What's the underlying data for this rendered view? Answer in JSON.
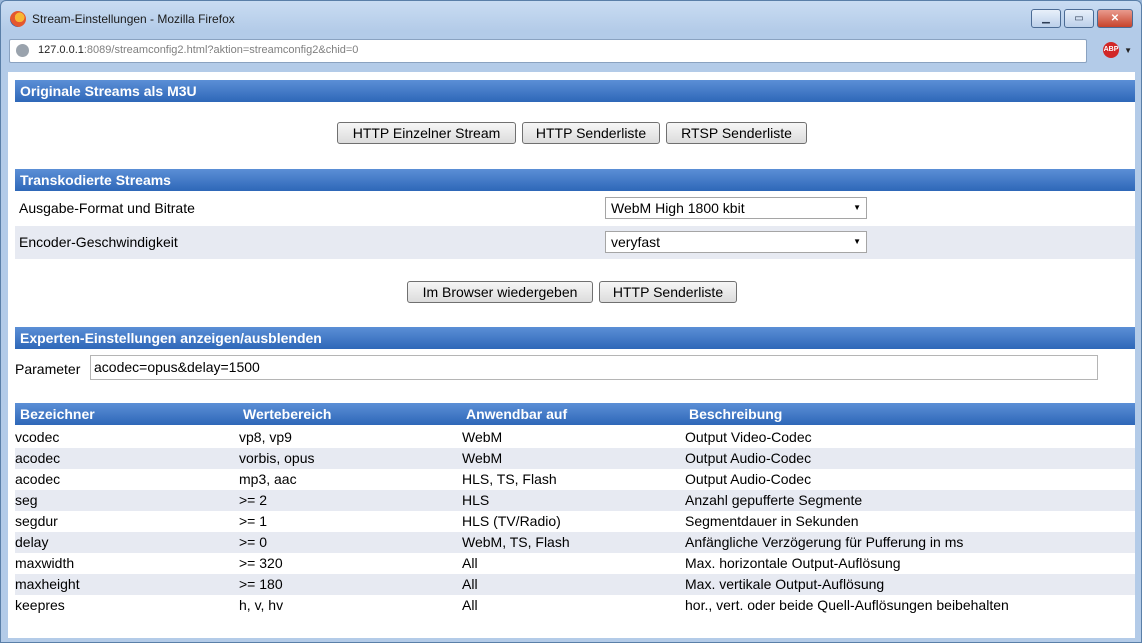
{
  "window": {
    "title": "Stream-Einstellungen - Mozilla Firefox"
  },
  "browser": {
    "url_host": "127.0.0.1",
    "url_rest": ":8089/streamconfig2.html?aktion=streamconfig2&chid=0",
    "addon": "ABP"
  },
  "section1": {
    "title": "Originale Streams als M3U",
    "buttons": [
      "HTTP Einzelner Stream",
      "HTTP Senderliste",
      "RTSP Senderliste"
    ]
  },
  "section2": {
    "title": "Transkodierte Streams",
    "rows": [
      {
        "label": "Ausgabe-Format und Bitrate",
        "value": "WebM High 1800 kbit"
      },
      {
        "label": "Encoder-Geschwindigkeit",
        "value": "veryfast"
      }
    ],
    "buttons": [
      "Im Browser wiedergeben",
      "HTTP Senderliste"
    ]
  },
  "section3": {
    "title": "Experten-Einstellungen anzeigen/ausblenden",
    "param_label": "Parameter",
    "param_value": "acodec=opus&delay=1500"
  },
  "table": {
    "headers": [
      "Bezeichner",
      "Wertebereich",
      "Anwendbar auf",
      "Beschreibung"
    ],
    "rows": [
      [
        "vcodec",
        "vp8, vp9",
        "WebM",
        "Output Video-Codec"
      ],
      [
        "acodec",
        "vorbis, opus",
        "WebM",
        "Output Audio-Codec"
      ],
      [
        "acodec",
        "mp3, aac",
        "HLS, TS, Flash",
        "Output Audio-Codec"
      ],
      [
        "seg",
        ">= 2",
        "HLS",
        "Anzahl gepufferte Segmente"
      ],
      [
        "segdur",
        ">= 1",
        "HLS (TV/Radio)",
        "Segmentdauer in Sekunden"
      ],
      [
        "delay",
        ">= 0",
        "WebM, TS, Flash",
        "Anfängliche Verzögerung für Pufferung in ms"
      ],
      [
        "maxwidth",
        ">= 320",
        "All",
        "Max. horizontale Output-Auflösung"
      ],
      [
        "maxheight",
        ">= 180",
        "All",
        "Max. vertikale Output-Auflösung"
      ],
      [
        "keepres",
        "h, v, hv",
        "All",
        "hor., vert. oder beide Quell-Auflösungen beibehalten"
      ]
    ]
  }
}
